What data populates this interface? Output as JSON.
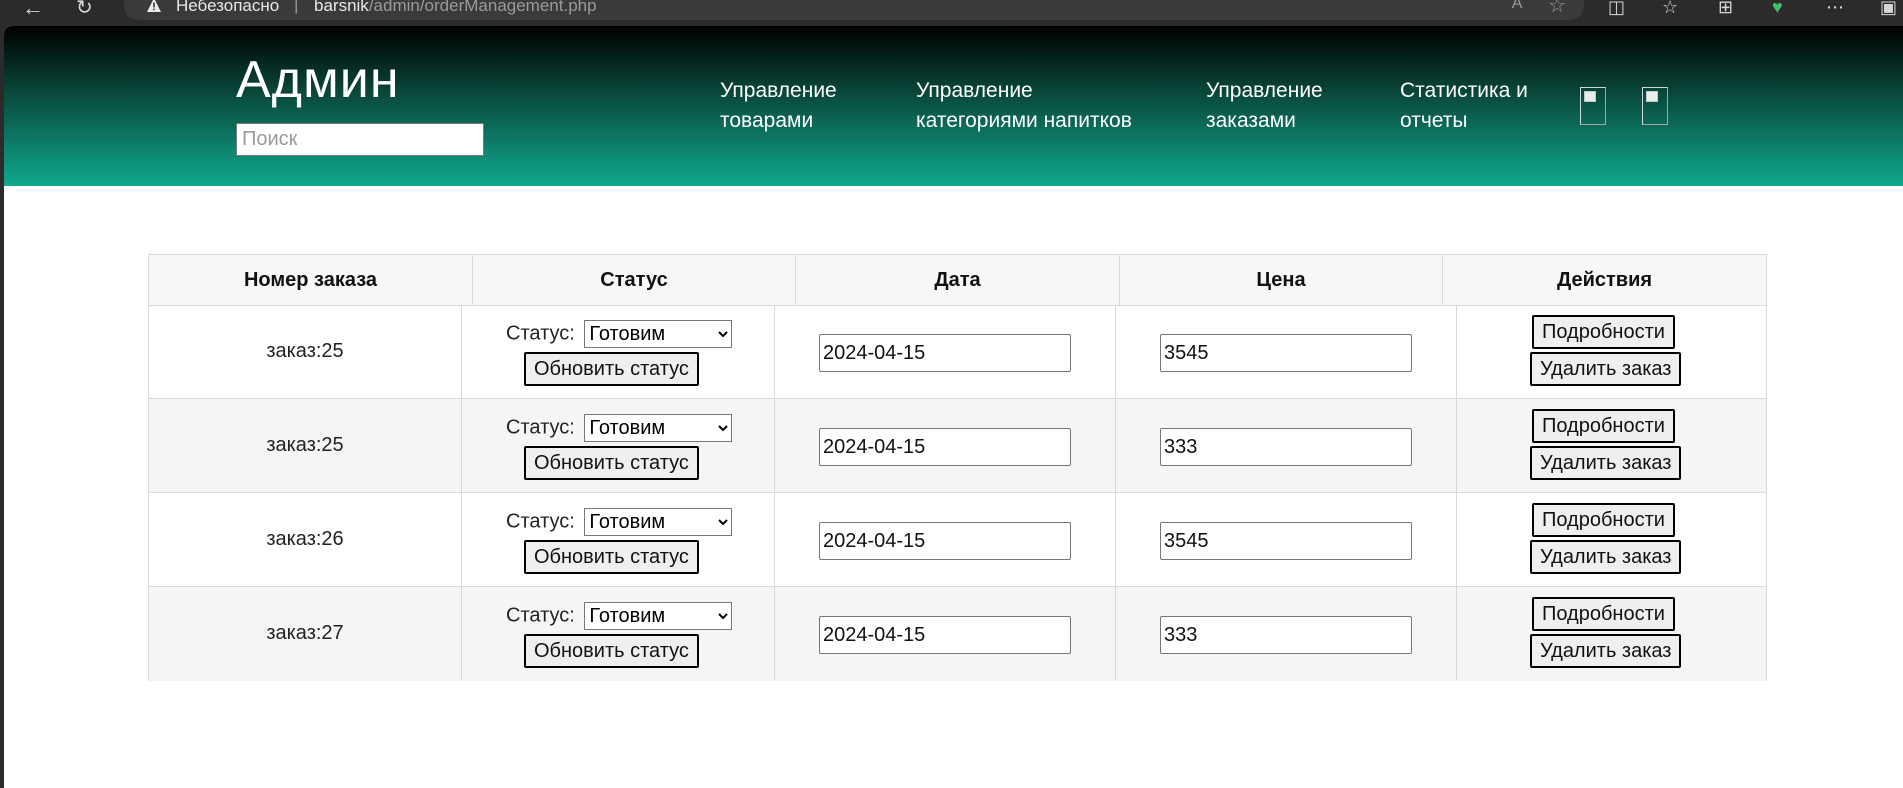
{
  "browser": {
    "insecure_label": "Небезопасно",
    "separator": "|",
    "url_host": "barsnik",
    "url_path": "/admin/orderManagement.php",
    "read_aloud": "Aʻ"
  },
  "header": {
    "brand": "Админ",
    "search_placeholder": "Поиск",
    "nav": [
      {
        "line1": "Управление",
        "line2": "товарами"
      },
      {
        "line1": "Управление",
        "line2": "категориями напитков"
      },
      {
        "line1": "Управление",
        "line2": "заказами"
      },
      {
        "line1": "Статистика и",
        "line2": "отчеты"
      }
    ]
  },
  "table": {
    "headers": [
      "Номер заказа",
      "Статус",
      "Дата",
      "Цена",
      "Действия"
    ],
    "status_label": "Статус:",
    "update_status_button": "Обновить статус",
    "details_button": "Подробности",
    "delete_button": "Удалить заказ",
    "rows": [
      {
        "order": "заказ:25",
        "status": "Готовим",
        "date": "2024-04-15",
        "price": "3545"
      },
      {
        "order": "заказ:25",
        "status": "Готовим",
        "date": "2024-04-15",
        "price": "333"
      },
      {
        "order": "заказ:26",
        "status": "Готовим",
        "date": "2024-04-15",
        "price": "3545"
      },
      {
        "order": "заказ:27",
        "status": "Готовим",
        "date": "2024-04-15",
        "price": "333"
      }
    ]
  },
  "colors": {
    "header_top": "#000000",
    "header_bottom": "#10a98e",
    "row_alt": "#f5f5f5"
  }
}
